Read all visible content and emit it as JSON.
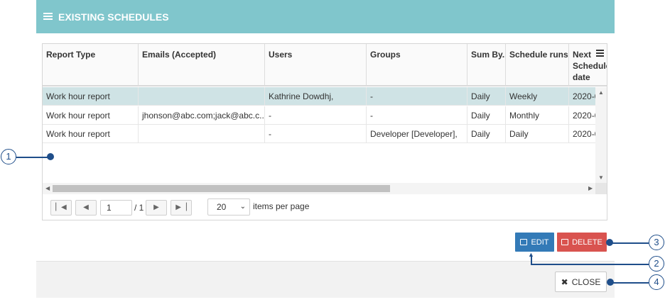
{
  "panel": {
    "title": "EXISTING SCHEDULES",
    "icon": "list-icon"
  },
  "grid": {
    "columns": [
      {
        "label": "Report Type"
      },
      {
        "label": "Emails (Accepted)"
      },
      {
        "label": "Users"
      },
      {
        "label": "Groups"
      },
      {
        "label": "Sum By.."
      },
      {
        "label": "Schedule runs.."
      },
      {
        "label": "Next Schedule date"
      }
    ],
    "rows": [
      {
        "report_type": "Work hour report",
        "emails": "",
        "users": "Kathrine Dowdhj,",
        "groups": "-",
        "sum_by": "Daily",
        "runs": "Weekly",
        "next": "2020-0"
      },
      {
        "report_type": "Work hour report",
        "emails": "jhonson@abc.com;jack@abc.c...",
        "users": "-",
        "groups": "-",
        "sum_by": "Daily",
        "runs": "Monthly",
        "next": "2020-0"
      },
      {
        "report_type": "Work hour report",
        "emails": "",
        "users": "-",
        "groups": "Developer [Developer],",
        "sum_by": "Daily",
        "runs": "Daily",
        "next": "2020-0"
      }
    ],
    "selected_row": 0
  },
  "pager": {
    "current_page": "1",
    "total_pages": "/ 1",
    "page_size": "20",
    "items_label": "items per page"
  },
  "buttons": {
    "edit": "EDIT",
    "delete": "DELETE",
    "close": "CLOSE"
  },
  "callouts": [
    "1",
    "2",
    "3",
    "4"
  ],
  "colors": {
    "header_bg": "#80c6cc",
    "selected_row": "#cfe3e5",
    "edit_bg": "#337ab7",
    "delete_bg": "#d9534f",
    "callout": "#1f4e8a"
  }
}
